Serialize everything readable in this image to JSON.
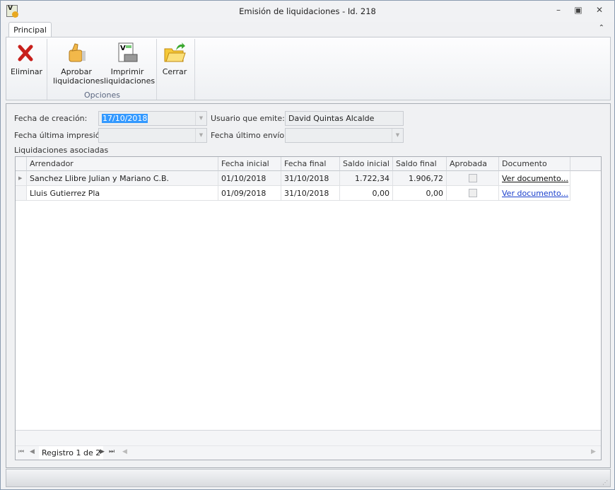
{
  "window": {
    "title": "Emisión de liquidaciones - Id. 218",
    "icons": [
      "minimize-icon",
      "restore-icon",
      "close-icon"
    ]
  },
  "ribbon": {
    "tab": "Principal",
    "buttons": {
      "delete": "Eliminar",
      "approve": "Aprobar liquidaciones",
      "print": "Imprimir liquidaciones",
      "close": "Cerrar"
    },
    "group_label": "Opciones"
  },
  "form": {
    "creation_date_label": "Fecha de creación:",
    "creation_date": "17/10/2018",
    "user_label": "Usuario que emite:",
    "user": "David Quintas Alcalde",
    "last_print_label": "Fecha última impresión:",
    "last_print": "",
    "last_send_label": "Fecha último envío:",
    "last_send": "",
    "section_label": "Liquidaciones asociadas"
  },
  "grid": {
    "columns": [
      "Arrendador",
      "Fecha inicial",
      "Fecha final",
      "Saldo inicial",
      "Saldo final",
      "Aprobada",
      "Documento"
    ],
    "rows": [
      {
        "arrendador": "Sanchez Llibre Julian y Mariano C.B.",
        "fecha_inicial": "01/10/2018",
        "fecha_final": "31/10/2018",
        "saldo_inicial": "1.722,34",
        "saldo_final": "1.906,72",
        "aprobada": false,
        "documento": "Ver documento..."
      },
      {
        "arrendador": "Lluis Gutierrez Pla",
        "fecha_inicial": "01/09/2018",
        "fecha_final": "31/10/2018",
        "saldo_inicial": "0,00",
        "saldo_final": "0,00",
        "aprobada": false,
        "documento": "Ver documento..."
      }
    ],
    "navigator": "Registro 1 de 2"
  },
  "colors": {
    "selection": "#3399ff",
    "link": "#1a3fcc"
  }
}
